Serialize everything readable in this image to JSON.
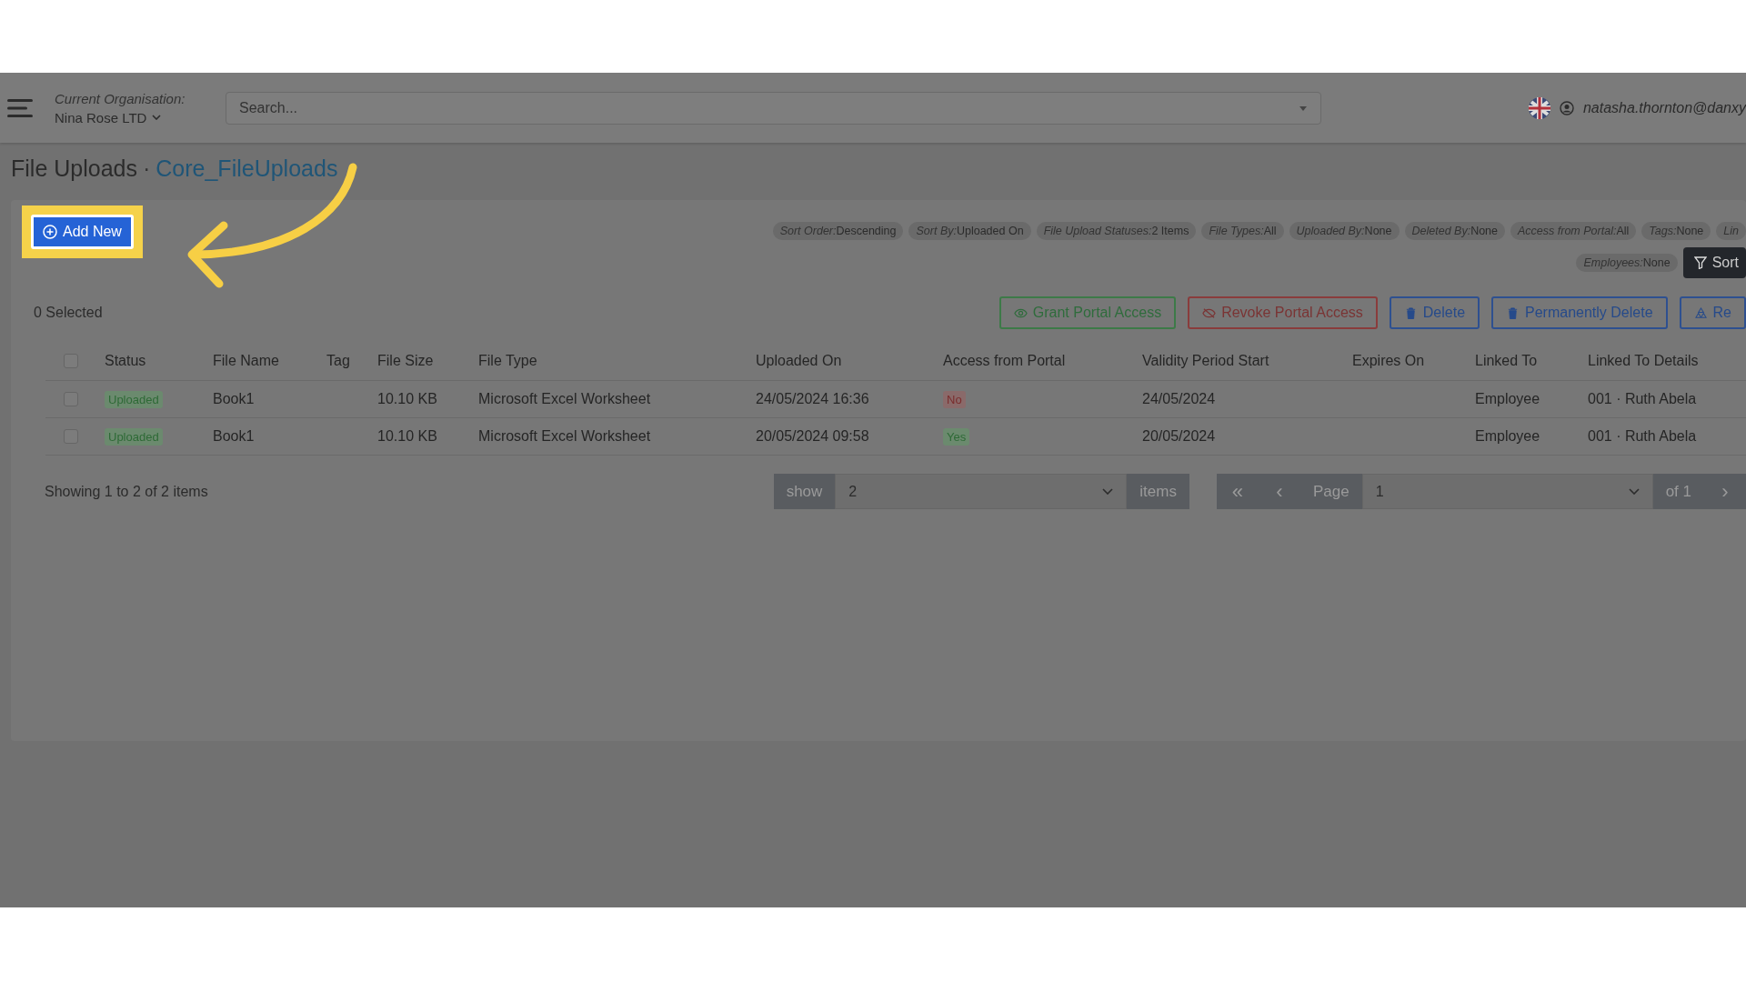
{
  "header": {
    "org_label": "Current Organisation:",
    "org_name": "Nina Rose LTD",
    "search_placeholder": "Search...",
    "user": "natasha.thornton@danxy"
  },
  "breadcrumb": {
    "title": "File Uploads",
    "separator": "·",
    "link": "Core_FileUploads"
  },
  "add_button": {
    "label": "Add New",
    "highlighted": true
  },
  "filters": [
    {
      "label": "Sort Order:",
      "value": "Descending"
    },
    {
      "label": "Sort By:",
      "value": "Uploaded On"
    },
    {
      "label": "File Upload Statuses:",
      "value": "2 Items"
    },
    {
      "label": "File Types:",
      "value": "All"
    },
    {
      "label": "Uploaded By:",
      "value": "None"
    },
    {
      "label": "Deleted By:",
      "value": "None"
    },
    {
      "label": "Access from Portal:",
      "value": "All"
    },
    {
      "label": "Tags:",
      "value": "None"
    },
    {
      "label": "Lin"
    }
  ],
  "filters_row2": [
    {
      "label": "Employees:",
      "value": "None"
    }
  ],
  "sort_button": "Sort",
  "selected_count": "0 Selected",
  "actions": [
    {
      "label": "Grant Portal Access",
      "kind": "grant"
    },
    {
      "label": "Revoke Portal Access",
      "kind": "revoke"
    },
    {
      "label": "Delete",
      "kind": "delete"
    },
    {
      "label": "Permanently Delete",
      "kind": "delete"
    },
    {
      "label": "Re",
      "kind": "restore"
    }
  ],
  "table": {
    "select_all_checked": false,
    "columns": [
      "Status",
      "File Name",
      "Tag",
      "File Size",
      "File Type",
      "Uploaded On",
      "Access from Portal",
      "Validity Period Start",
      "Expires On",
      "Linked To",
      "Linked To Details"
    ],
    "rows": [
      {
        "checked": false,
        "status": "Uploaded",
        "file_name": "Book1",
        "file_size": "10.10 KB",
        "file_type": "Microsoft Excel Worksheet",
        "uploaded_on": "24/05/2024 16:36",
        "access": "No",
        "granted": false,
        "validity_start": "24/05/2024",
        "linked_to": "Employee",
        "linked_details": "001 · Ruth Abela"
      },
      {
        "checked": false,
        "status": "Uploaded",
        "file_name": "Book1",
        "file_size": "10.10 KB",
        "file_type": "Microsoft Excel Worksheet",
        "uploaded_on": "20/05/2024 09:58",
        "access": "Yes",
        "granted": true,
        "validity_start": "20/05/2024",
        "linked_to": "Employee",
        "linked_details": "001 · Ruth Abela"
      }
    ]
  },
  "footer": {
    "showing": "Showing 1 to 2 of 2 items",
    "show_label": "show",
    "page_size": "2",
    "items_label": "items",
    "first": "«",
    "prev": "‹",
    "page_label": "Page",
    "page": "1",
    "of": "of 1",
    "next": "›"
  }
}
